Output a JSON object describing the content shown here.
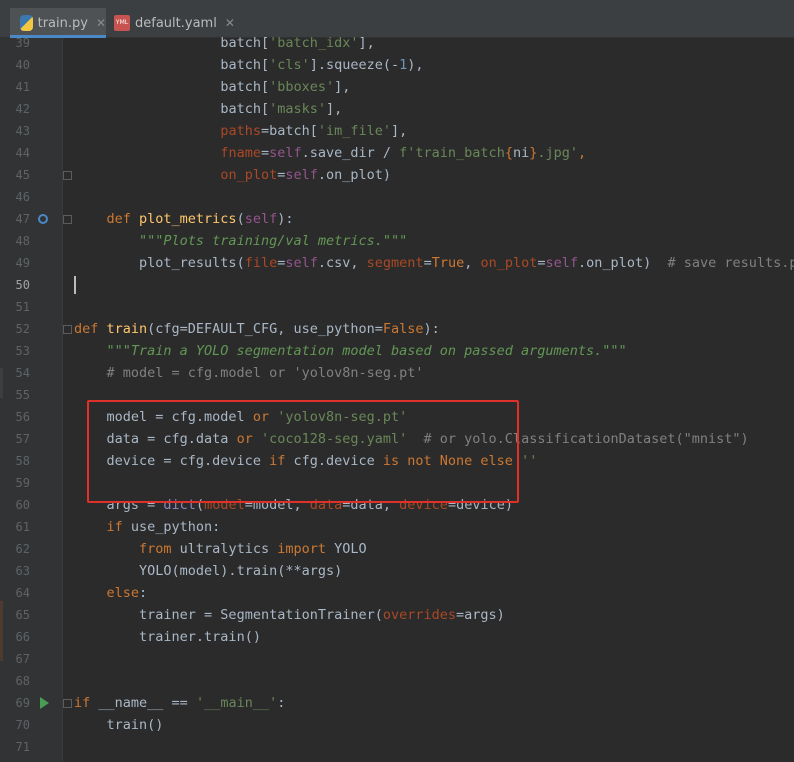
{
  "tabs": [
    {
      "label": "train.py",
      "icon": "python-file-icon",
      "active": true
    },
    {
      "label": "default.yaml",
      "icon": "yaml-file-icon",
      "active": false
    }
  ],
  "colors": {
    "keyword": "#cc7832",
    "string": "#6a8759",
    "function": "#ffc66d",
    "comment": "#808080",
    "highlight_box": "#e0302a"
  },
  "lines": [
    {
      "n": "39",
      "tokens": [
        [
          "",
          "                  "
        ],
        [
          "",
          "batch["
        ],
        [
          "str",
          "'batch_idx'"
        ],
        [
          "",
          "],"
        ]
      ]
    },
    {
      "n": "40",
      "tokens": [
        [
          "",
          "                  "
        ],
        [
          "",
          "batch["
        ],
        [
          "str",
          "'cls'"
        ],
        [
          "",
          "].squeeze(-"
        ],
        [
          "num",
          "1"
        ],
        [
          "",
          "),"
        ]
      ]
    },
    {
      "n": "41",
      "tokens": [
        [
          "",
          "                  "
        ],
        [
          "",
          "batch["
        ],
        [
          "str",
          "'bboxes'"
        ],
        [
          "",
          "],"
        ]
      ]
    },
    {
      "n": "42",
      "tokens": [
        [
          "",
          "                  "
        ],
        [
          "",
          "batch["
        ],
        [
          "str",
          "'masks'"
        ],
        [
          "",
          "],"
        ]
      ]
    },
    {
      "n": "43",
      "tokens": [
        [
          "",
          "                  "
        ],
        [
          "param",
          "paths"
        ],
        [
          "",
          "=batch["
        ],
        [
          "str",
          "'im_file'"
        ],
        [
          "",
          "],"
        ]
      ]
    },
    {
      "n": "44",
      "tokens": [
        [
          "",
          "                  "
        ],
        [
          "param",
          "fname"
        ],
        [
          "",
          "="
        ],
        [
          "self",
          "self"
        ],
        [
          "",
          ".save_dir / "
        ],
        [
          "str",
          "f'train_batch"
        ],
        [
          "kw",
          "{"
        ],
        [
          "",
          "ni"
        ],
        [
          "kw",
          "}"
        ],
        [
          "str",
          ".jpg'"
        ],
        [
          "kw",
          ","
        ]
      ]
    },
    {
      "n": "45",
      "tokens": [
        [
          "",
          "                  "
        ],
        [
          "param",
          "on_plot"
        ],
        [
          "",
          "="
        ],
        [
          "self",
          "self"
        ],
        [
          "",
          ".on_plot)"
        ]
      ]
    },
    {
      "n": "46",
      "tokens": []
    },
    {
      "n": "47",
      "tokens": [
        [
          "",
          "    "
        ],
        [
          "kw",
          "def "
        ],
        [
          "fn",
          "plot_metrics"
        ],
        [
          "",
          "("
        ],
        [
          "self",
          "self"
        ],
        [
          "",
          "):"
        ]
      ]
    },
    {
      "n": "48",
      "tokens": [
        [
          "",
          "        "
        ],
        [
          "doc",
          "\"\"\"Plots training/val metrics.\"\"\""
        ]
      ]
    },
    {
      "n": "49",
      "tokens": [
        [
          "",
          "        "
        ],
        [
          "",
          "plot_results("
        ],
        [
          "param",
          "file"
        ],
        [
          "",
          "="
        ],
        [
          "self",
          "self"
        ],
        [
          "",
          ".csv, "
        ],
        [
          "param",
          "segment"
        ],
        [
          "",
          "="
        ],
        [
          "kw",
          "True"
        ],
        [
          "",
          ", "
        ],
        [
          "param",
          "on_plot"
        ],
        [
          "",
          "="
        ],
        [
          "self",
          "self"
        ],
        [
          "",
          ".on_plot)  "
        ],
        [
          "cmt",
          "# save results.pn"
        ]
      ]
    },
    {
      "n": "50",
      "tokens": []
    },
    {
      "n": "51",
      "tokens": []
    },
    {
      "n": "52",
      "tokens": [
        [
          "kw",
          "def "
        ],
        [
          "fn",
          "train"
        ],
        [
          "",
          "(cfg=DEFAULT_CFG, use_python="
        ],
        [
          "kw",
          "False"
        ],
        [
          "",
          "):"
        ]
      ]
    },
    {
      "n": "53",
      "tokens": [
        [
          "",
          "    "
        ],
        [
          "doc",
          "\"\"\"Train a YOLO segmentation model based on passed arguments.\"\"\""
        ]
      ]
    },
    {
      "n": "54",
      "tokens": [
        [
          "",
          "    "
        ],
        [
          "cmt",
          "# model = cfg.model or 'yolov8n-seg.pt'"
        ]
      ]
    },
    {
      "n": "55",
      "tokens": []
    },
    {
      "n": "56",
      "tokens": [
        [
          "",
          "    "
        ],
        [
          "",
          "model = cfg.model "
        ],
        [
          "kw",
          "or "
        ],
        [
          "str",
          "'yolov8n-seg.pt'"
        ]
      ]
    },
    {
      "n": "57",
      "tokens": [
        [
          "",
          "    "
        ],
        [
          "",
          "data = cfg.data "
        ],
        [
          "kw",
          "or "
        ],
        [
          "str",
          "'coco128-seg.yaml'"
        ],
        [
          "",
          "  "
        ],
        [
          "cmt",
          "# or yolo.ClassificationDataset(\"mnist\")"
        ]
      ]
    },
    {
      "n": "58",
      "tokens": [
        [
          "",
          "    "
        ],
        [
          "",
          "device = cfg.device "
        ],
        [
          "kw",
          "if "
        ],
        [
          "",
          "cfg.device "
        ],
        [
          "kw",
          "is not "
        ],
        [
          "kw",
          "None "
        ],
        [
          "kw",
          "else "
        ],
        [
          "str",
          "''"
        ]
      ]
    },
    {
      "n": "59",
      "tokens": []
    },
    {
      "n": "60",
      "tokens": [
        [
          "",
          "    "
        ],
        [
          "",
          "args = "
        ],
        [
          "builtin",
          "dict"
        ],
        [
          "",
          "("
        ],
        [
          "param",
          "model"
        ],
        [
          "",
          "=model, "
        ],
        [
          "param",
          "data"
        ],
        [
          "",
          "=data, "
        ],
        [
          "param",
          "device"
        ],
        [
          "",
          "=device)"
        ]
      ]
    },
    {
      "n": "61",
      "tokens": [
        [
          "",
          "    "
        ],
        [
          "kw",
          "if "
        ],
        [
          "",
          "use_python:"
        ]
      ]
    },
    {
      "n": "62",
      "tokens": [
        [
          "",
          "        "
        ],
        [
          "kw",
          "from "
        ],
        [
          "",
          "ultralytics "
        ],
        [
          "kw",
          "import "
        ],
        [
          "",
          "YOLO"
        ]
      ]
    },
    {
      "n": "63",
      "tokens": [
        [
          "",
          "        "
        ],
        [
          "",
          "YOLO(model).train(**args)"
        ]
      ]
    },
    {
      "n": "64",
      "tokens": [
        [
          "",
          "    "
        ],
        [
          "kw",
          "else"
        ],
        [
          "",
          ":"
        ]
      ]
    },
    {
      "n": "65",
      "tokens": [
        [
          "",
          "        "
        ],
        [
          "",
          "trainer = SegmentationTrainer("
        ],
        [
          "param",
          "overrides"
        ],
        [
          "",
          "=args)"
        ]
      ]
    },
    {
      "n": "66",
      "tokens": [
        [
          "",
          "        "
        ],
        [
          "",
          "trainer.train()"
        ]
      ]
    },
    {
      "n": "67",
      "tokens": []
    },
    {
      "n": "68",
      "tokens": []
    },
    {
      "n": "69",
      "tokens": [
        [
          "kw",
          "if "
        ],
        [
          "",
          "__name__ == "
        ],
        [
          "str",
          "'__main__'"
        ],
        [
          "",
          ":"
        ]
      ]
    },
    {
      "n": "70",
      "tokens": [
        [
          "",
          "    "
        ],
        [
          "",
          "train()"
        ]
      ]
    },
    {
      "n": "71",
      "tokens": []
    }
  ]
}
